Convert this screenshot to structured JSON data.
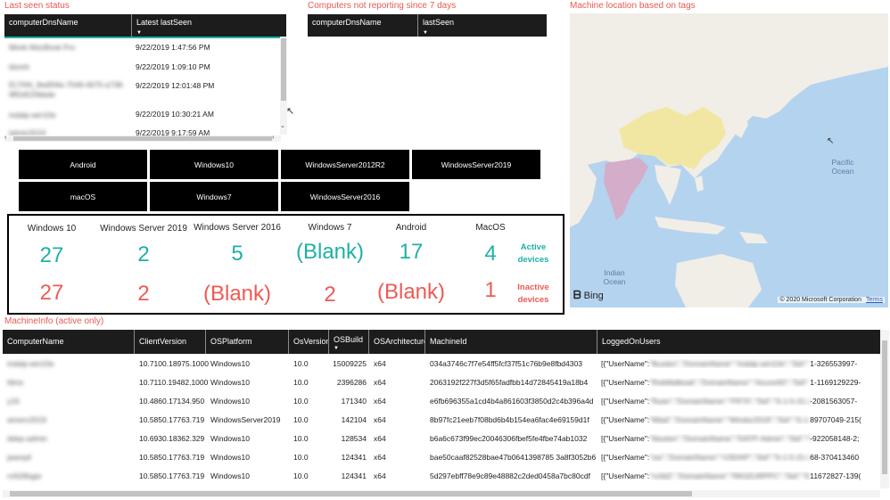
{
  "last_seen": {
    "title": "Last seen status",
    "columns": [
      "computerDnsName",
      "Latest lastSeen"
    ],
    "rows": [
      {
        "name": "Mirek MacBook Pro",
        "time": "9/22/2019 1:47:56 PM"
      },
      {
        "name": "ldomh",
        "time": "9/22/2019 1:09:10 PM"
      },
      {
        "name": "ELTAN_9ed5f4e-7549-4675-a738-",
        "name2": "9ff2d520bbde",
        "time": "9/22/2019 12:01:48 PM"
      },
      {
        "name": "indalp-win10e",
        "time": "9/22/2019 10:30:21 AM"
      },
      {
        "name": "lalmin2019",
        "time": "9/22/2019 9:17:59 AM"
      }
    ]
  },
  "not_reporting": {
    "title": "Computers not reporting since 7 days",
    "columns": [
      "computerDnsName",
      "lastSeen"
    ]
  },
  "map": {
    "title": "Machine location based on tags",
    "labels": {
      "pacific1": "Pacific",
      "pacific2": "Ocean",
      "indian1": "Indian",
      "indian2": "Ocean"
    },
    "bing": "Bing",
    "copyright": "© 2020 Microsoft Corporation",
    "terms": "Terms",
    "colors": {
      "water": "#b4d3ef",
      "land": "#f1eee8",
      "china": "#f2e7a2",
      "india": "#d3adc9"
    }
  },
  "slicers": [
    "Android",
    "Windows10",
    "WindowsServer2012R2",
    "WindowsServer2019",
    "macOS",
    "Windows7",
    "WindowsServer2016"
  ],
  "summary": {
    "headers": [
      "Windows 10",
      "Windows Server 2019",
      "Windows Server 2016",
      "Windows 7",
      "Android",
      "MacOS"
    ],
    "active": [
      "27",
      "2",
      "5",
      "(Blank)",
      "17",
      "4"
    ],
    "inactive": [
      "27",
      "2",
      "(Blank)",
      "2",
      "(Blank)",
      "1"
    ],
    "active_label1": "Active",
    "active_label2": "devices",
    "inactive_label1": "Inactive",
    "inactive_label2": "devices",
    "colors": {
      "active": "#1fb0a6",
      "inactive": "#ee5a56"
    }
  },
  "machine_info": {
    "title": "MachineInfo (active only)",
    "columns": [
      "ComputerName",
      "ClientVersion",
      "OSPlatform",
      "OsVersion",
      "OSBuild",
      "OSArchitecture",
      "MachineId",
      "LoggedOnUsers"
    ],
    "rows": [
      {
        "c": "indalp-win10e",
        "cv": "10.7100.18975.1000",
        "os": "Windows10",
        "ov": "10.0",
        "b": "15009225",
        "a": "x64",
        "m": "034a3746c7f7e54ff5fcf37f51c76b9e8fbd4303",
        "u1": "[{\"UserName\":",
        "ub": "\"fkusten\",\"DomainName\":\"indalp-win10e\",\"Sid\":\"S-1-5-2",
        "u2": "1-326553997-"
      },
      {
        "c": "fdmx",
        "cv": "10.7110.19482.1000",
        "os": "Windows10",
        "ov": "10.0",
        "b": "2396286",
        "a": "x64",
        "m": "2063192f227f3d5f65fadfbb14d72845419a18b4",
        "u1": "[{\"UserName\":",
        "ub": "\"RobMalbosk\",\"DomainName\":\"AzureAD\",\"Sid\":\"S-1-12-",
        "u2": "1-1169129229-"
      },
      {
        "c": "y16",
        "cv": "10.4860.17134.950",
        "os": "Windows10",
        "ov": "10.0",
        "b": "171340",
        "a": "x64",
        "m": "e6fb696355a1cd4b4a861603f3850d2c4b396a4d",
        "u1": "[{\"UserName\":",
        "ub": "\"Ryan\",\"DomainName\":\"FR70\",\"Sid\":\"S-1-5-21-26880",
        "u2": "-2081563057-"
      },
      {
        "c": "wmerv2019",
        "cv": "10.5850.17763.719",
        "os": "WindowsServer2019",
        "ov": "10.0",
        "b": "142104",
        "a": "x64",
        "m": "8b97fc21eeb7f08bd6b4b154ea6fac4e69159d1f",
        "u1": "[{\"UserName\":",
        "ub": "\"Mlad\",\"DomainName\":\"Windsr2019\",\"Sid\":\"S-1-5-21-25",
        "u2": "89707049-215("
      },
      {
        "c": "ddep-admin",
        "cv": "10.6930.18362.329",
        "os": "Windows10",
        "ov": "10.0",
        "b": "128534",
        "a": "x64",
        "m": "b6a6c673f99ec20046306fbef5fe4fbe74ab1032",
        "u1": "[{\"UserName\":",
        "ub": "\"fdusten\",\"DomainName\":\"DATP-Admin\",\"Sid\":\"S-1-5-21",
        "u2": "-922058148-2;"
      },
      {
        "c": "jawoq4",
        "cv": "10.5850.17763.719",
        "os": "Windows10",
        "ov": "10.0",
        "b": "124341",
        "a": "x64",
        "m": "bae50caaf82528bae47b0641398785 3a8f3052b6",
        "u1": "[{\"UserName\":",
        "ub": "\"ow\",\"DomainName\":\"USDAP\",\"Sid\":\"S-1-5-21-31860",
        "u2": "68-370413460"
      },
      {
        "c": "rv5l28sgw",
        "cv": "10.5850.17763.719",
        "os": "Windows10",
        "ov": "10.0",
        "b": "124341",
        "a": "x64",
        "m": "5d297ebff78e9c89e48882c2ded0458a7bc80cdf",
        "u1": "[{\"UserName\":",
        "ub": "\"ro3d2\",\"DomainName\":\"RK0ZURPPC\",\"Sid\":\"S-1-5-21-3",
        "u2": "11672827-139("
      }
    ]
  }
}
